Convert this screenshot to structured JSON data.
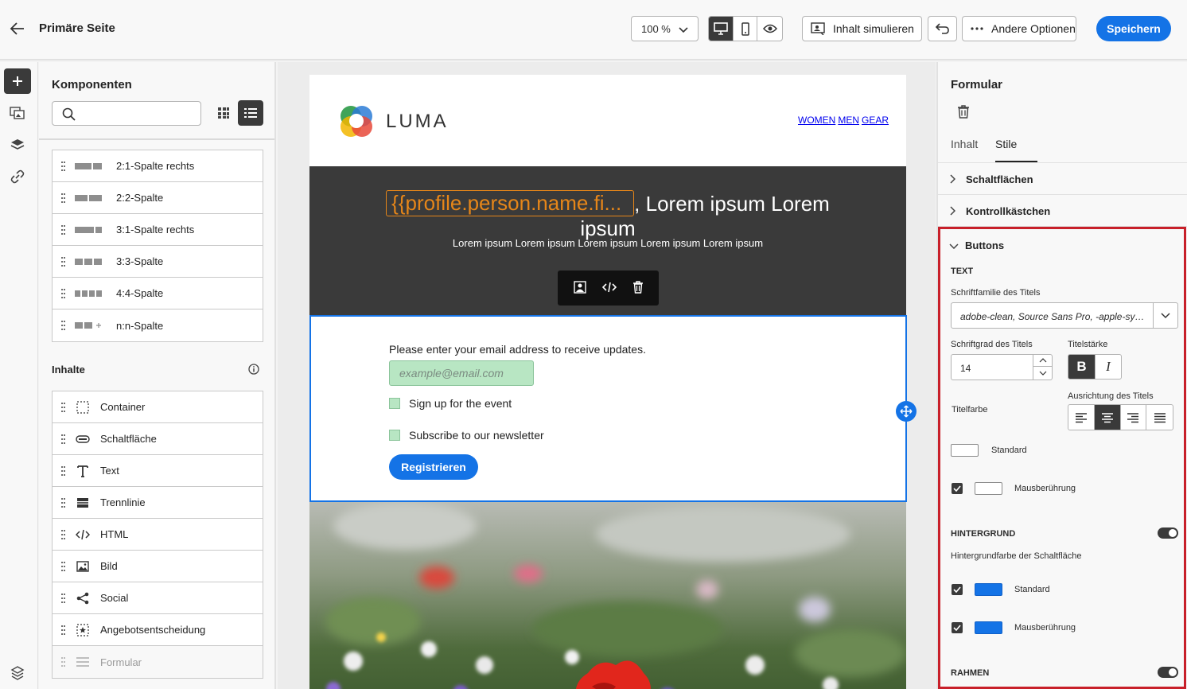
{
  "header": {
    "title": "Primäre Seite",
    "zoom": "100 %",
    "simulate_label": "Inhalt simulieren",
    "options_label": "Andere Optionen",
    "save_label": "Speichern"
  },
  "components": {
    "title": "Komponenten",
    "search_placeholder": "",
    "layout_items": [
      {
        "label": "2:1-Spalte rechts",
        "icon": "two-one-column-icon"
      },
      {
        "label": "2:2-Spalte",
        "icon": "two-two-column-icon"
      },
      {
        "label": "3:1-Spalte rechts",
        "icon": "three-one-column-icon"
      },
      {
        "label": "3:3-Spalte",
        "icon": "three-three-column-icon"
      },
      {
        "label": "4:4-Spalte",
        "icon": "four-four-column-icon"
      },
      {
        "label": "n:n-Spalte",
        "icon": "n-n-column-icon"
      }
    ],
    "content_section_title": "Inhalte",
    "content_items": [
      {
        "label": "Container",
        "icon": "container-icon"
      },
      {
        "label": "Schaltfläche",
        "icon": "button-icon"
      },
      {
        "label": "Text",
        "icon": "text-icon"
      },
      {
        "label": "Trennlinie",
        "icon": "divider-icon"
      },
      {
        "label": "HTML",
        "icon": "html-icon"
      },
      {
        "label": "Bild",
        "icon": "image-icon"
      },
      {
        "label": "Social",
        "icon": "share-icon"
      },
      {
        "label": "Angebotsentscheidung",
        "icon": "offer-icon"
      },
      {
        "label": "Formular",
        "icon": "form-icon",
        "disabled": true
      }
    ]
  },
  "email": {
    "brand": "LUMA",
    "nav": [
      "WOMEN",
      "MEN",
      "GEAR"
    ],
    "hero_token": "{{profile.person.name.fi...",
    "hero_text": ", Lorem ipsum Lorem ipsum",
    "hero_sub": "Lorem ipsum Lorem ipsum Lorem ipsum Lorem ipsum Lorem ipsum",
    "form_prompt": "Please enter your email address to receive updates.",
    "email_placeholder": "example@email.com",
    "checkbox1": "Sign up for the event",
    "checkbox2": "Subscribe to our newsletter",
    "submit_label": "Registrieren"
  },
  "right_panel": {
    "title": "Formular",
    "tabs": [
      "Inhalt",
      "Stile"
    ],
    "active_tab": "Stile",
    "accordions": [
      "Schaltflächen",
      "Kontrollkästchen",
      "Buttons"
    ],
    "text_section": "TEXT",
    "font_family_label": "Schriftfamilie des Titels",
    "font_family_value": "adobe-clean, Source Sans Pro, -apple-system, BlinkMacSystemFont, Segoe UI, Roboto, Ubuntu, Trebuchet MS, Lucida Grande, sans-serif",
    "font_size_label": "Schriftgrad des Titels",
    "font_size_value": "14",
    "weight_label": "Titelstärke",
    "bold_label": "B",
    "italic_label": "I",
    "alignment_label": "Ausrichtung des Titels",
    "color_label": "Titelfarbe",
    "standard_label": "Standard",
    "hover_label": "Mausberührung",
    "background_section": "HINTERGRUND",
    "bg_color_label": "Hintergrundfarbe der Schaltfläche",
    "border_section": "RAHMEN",
    "colors": {
      "accent": "#1473e6",
      "title_standard": "#ffffff",
      "title_hover": "#ffffff",
      "bg_standard": "#1473e6",
      "bg_hover": "#1473e6",
      "highlight": "#c8202a"
    }
  }
}
